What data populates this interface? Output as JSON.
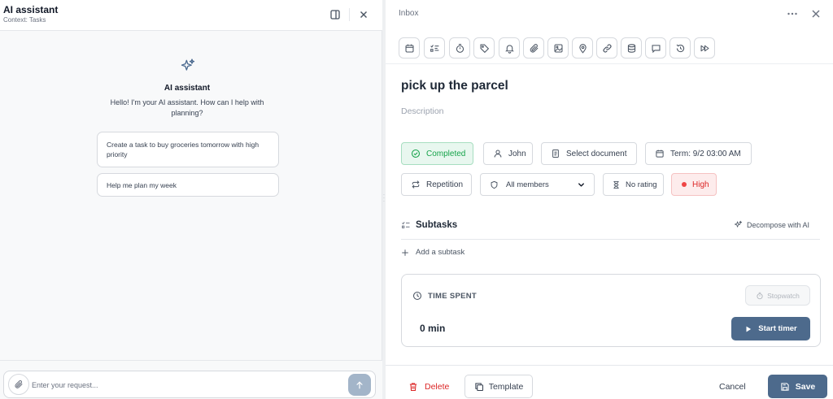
{
  "assistant": {
    "title": "AI assistant",
    "context": "Context: Tasks",
    "heading": "AI assistant",
    "greeting": "Hello! I'm your AI assistant. How can I help with planning?",
    "suggestions": [
      "Create a task to buy groceries tomorrow with high priority",
      "Help me plan my week"
    ],
    "input_placeholder": "Enter your request..."
  },
  "task": {
    "list": "Inbox",
    "title": "pick up the parcel",
    "description_placeholder": "Description",
    "status": "Completed",
    "assignee": "John",
    "document": "Select document",
    "term": "Term: 9/2 03:00 AM",
    "repetition": "Repetition",
    "members_selected": "All members",
    "rating": "No rating",
    "priority": "High",
    "priority_color": "#ef4444",
    "toolbar_icons": [
      "calendar-icon",
      "checklist-icon",
      "timer-icon",
      "tag-icon",
      "bell-icon",
      "paperclip-icon",
      "image-icon",
      "location-icon",
      "link-icon",
      "database-icon",
      "comment-icon",
      "history-icon",
      "fast-forward-icon"
    ]
  },
  "subtasks": {
    "title": "Subtasks",
    "decompose": "Decompose with AI",
    "add": "Add a subtask"
  },
  "time": {
    "label": "TIME SPENT",
    "stopwatch": "Stopwatch",
    "value": "0 min",
    "start": "Start timer"
  },
  "footer": {
    "delete": "Delete",
    "template": "Template",
    "cancel": "Cancel",
    "save": "Save"
  },
  "colors": {
    "accent": "#4d6a8c",
    "completed_green": "#16a34a",
    "danger": "#dc2626"
  }
}
